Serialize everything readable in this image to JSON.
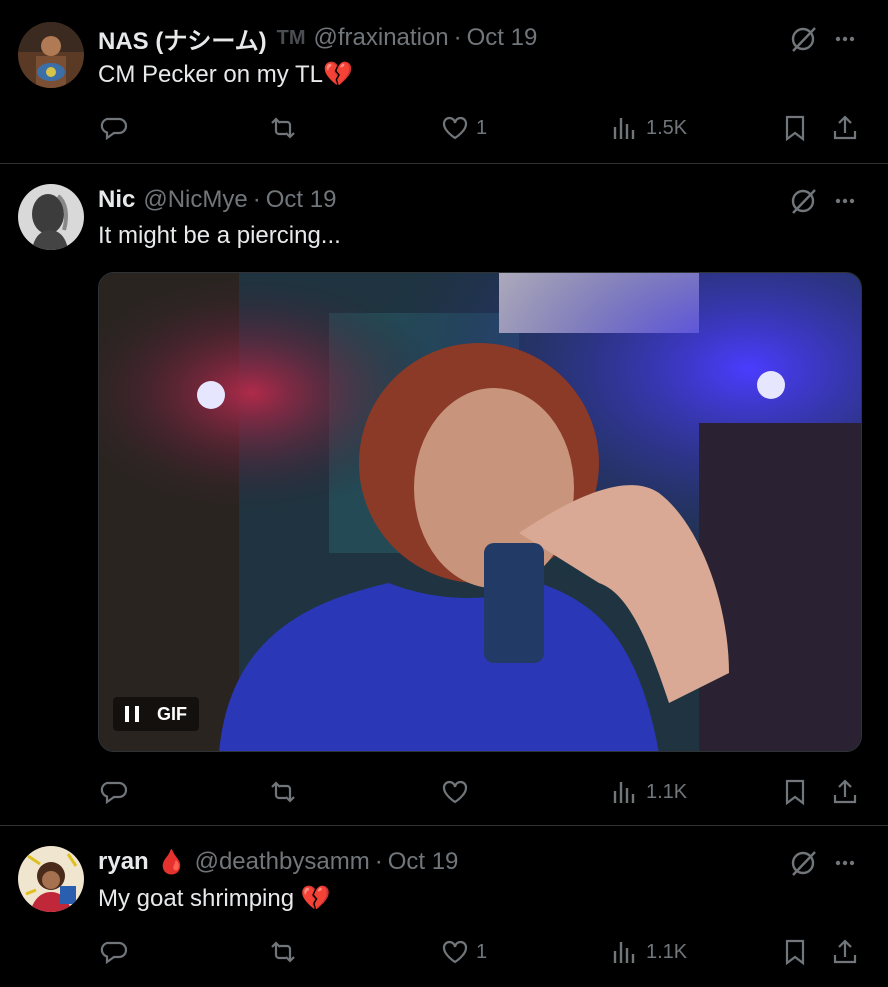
{
  "tweets": [
    {
      "name": "NAS (ナシーム)",
      "badge": "TM",
      "handle": "@fraxination",
      "sep": "·",
      "date": "Oct 19",
      "text": "CM Pecker on my TL",
      "emoji": "💔",
      "likes": "1",
      "views": "1.5K"
    },
    {
      "name": "Nic",
      "handle": "@NicMye",
      "sep": "·",
      "date": "Oct 19",
      "text": "It might be a piercing...",
      "media_label": "GIF",
      "likes": "",
      "views": "1.1K"
    },
    {
      "name": "ryan",
      "name_emoji": "🩸",
      "handle": "@deathbysamm",
      "sep": "·",
      "date": "Oct 19",
      "text": "My goat shrimping ",
      "emoji": "💔",
      "likes": "1",
      "views": "1.1K"
    }
  ],
  "colors": {
    "background": "#000000",
    "text": "#e7e9ea",
    "muted": "#71767b",
    "divider": "#2f3336",
    "heart_break": "#e0245e"
  },
  "icons": [
    "grok-icon",
    "more-icon",
    "reply-icon",
    "retweet-icon",
    "like-icon",
    "views-icon",
    "bookmark-icon",
    "share-icon",
    "pause-icon"
  ]
}
